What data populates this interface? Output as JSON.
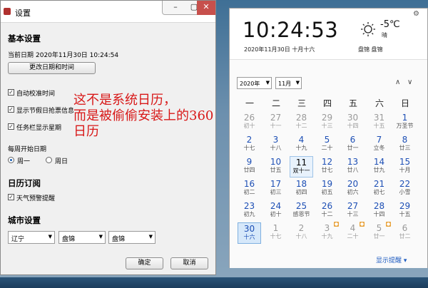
{
  "dialog": {
    "title": "设置",
    "basic": {
      "heading": "基本设置",
      "current_date_label": "当前日期",
      "current_date_value": "2020年11月30日 10:24:54",
      "change_btn": "更改日期和时间",
      "chk_auto_sync": "自动校准时间",
      "chk_holiday": "显示节假日抢票信息",
      "chk_taskbar_week": "任务栏显示星期",
      "week_start_label": "每周开始日期",
      "radio_monday": "周一",
      "radio_sunday": "周日"
    },
    "subscription": {
      "heading": "日历订阅",
      "chk_weather": "天气预警提醒"
    },
    "city": {
      "heading": "城市设置",
      "province": "辽宁",
      "city": "盘锦",
      "district": "盘锦"
    },
    "ok": "确定",
    "cancel": "取消"
  },
  "calendar": {
    "time": "10:24:53",
    "date_line": "2020年11月30日  十月十六",
    "temperature": "-5℃",
    "condition": "晴",
    "city": "盘锦 盘锦",
    "year_select": "2020年",
    "month_select": "11月",
    "nav_up": "∧",
    "nav_down": "∨",
    "weekdays": [
      "一",
      "二",
      "三",
      "四",
      "五",
      "六",
      "日"
    ],
    "show_reminders": "显示提醒",
    "rows": [
      [
        [
          "26",
          "初十",
          "other"
        ],
        [
          "27",
          "十一",
          "other"
        ],
        [
          "28",
          "十二",
          "other"
        ],
        [
          "29",
          "十三",
          "other"
        ],
        [
          "30",
          "十四",
          "other"
        ],
        [
          "31",
          "十五",
          "other"
        ],
        [
          "1",
          "万圣节",
          "cur"
        ]
      ],
      [
        [
          "2",
          "十七",
          "cur"
        ],
        [
          "3",
          "十八",
          "cur"
        ],
        [
          "4",
          "十九",
          "cur"
        ],
        [
          "5",
          "二十",
          "cur"
        ],
        [
          "6",
          "廿一",
          "cur"
        ],
        [
          "7",
          "立冬",
          "cur"
        ],
        [
          "8",
          "廿三",
          "cur"
        ]
      ],
      [
        [
          "9",
          "廿四",
          "cur"
        ],
        [
          "10",
          "廿五",
          "cur"
        ],
        [
          "11",
          "双十一",
          "sel"
        ],
        [
          "12",
          "廿七",
          "cur"
        ],
        [
          "13",
          "廿八",
          "cur"
        ],
        [
          "14",
          "廿九",
          "cur"
        ],
        [
          "15",
          "十月",
          "cur"
        ]
      ],
      [
        [
          "16",
          "初二",
          "cur"
        ],
        [
          "17",
          "初三",
          "cur"
        ],
        [
          "18",
          "初四",
          "cur"
        ],
        [
          "19",
          "初五",
          "cur"
        ],
        [
          "20",
          "初六",
          "cur"
        ],
        [
          "21",
          "初七",
          "cur"
        ],
        [
          "22",
          "小雪",
          "cur"
        ]
      ],
      [
        [
          "23",
          "初九",
          "cur"
        ],
        [
          "24",
          "初十",
          "cur"
        ],
        [
          "25",
          "感恩节",
          "cur"
        ],
        [
          "26",
          "十二",
          "cur"
        ],
        [
          "27",
          "十三",
          "cur"
        ],
        [
          "28",
          "十四",
          "cur"
        ],
        [
          "29",
          "十五",
          "cur"
        ]
      ],
      [
        [
          "30",
          "十六",
          "today"
        ],
        [
          "1",
          "十七",
          "other"
        ],
        [
          "2",
          "十八",
          "other"
        ],
        [
          "3",
          "十九",
          "other"
        ],
        [
          "4",
          "二十",
          "other"
        ],
        [
          "5",
          "廿一",
          "other"
        ],
        [
          "6",
          "廿二",
          "other"
        ]
      ]
    ]
  },
  "annotation": {
    "line1": "这不是系统日历，",
    "line2": "而是被偷偷安装上的360",
    "line3": "日历"
  }
}
